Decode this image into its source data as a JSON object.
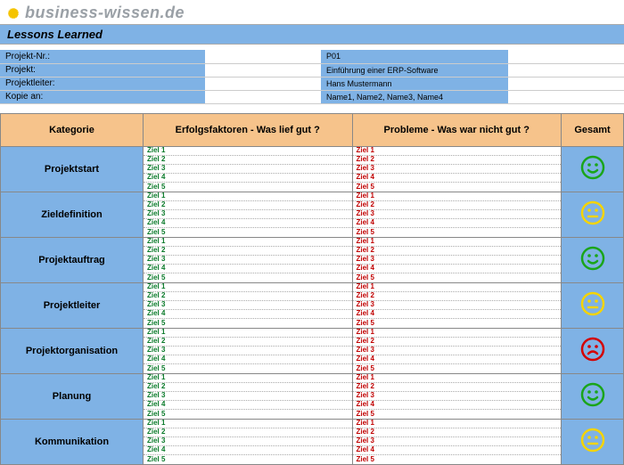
{
  "brand": "business-wissen.de",
  "title": "Lessons Learned",
  "meta": [
    {
      "label": "Projekt-Nr.:",
      "value": "P01"
    },
    {
      "label": "Projekt:",
      "value": "Einführung einer ERP-Software"
    },
    {
      "label": "Projektleiter:",
      "value": "Hans Mustermann"
    },
    {
      "label": "Kopie an:",
      "value": "Name1, Name2, Name3, Name4"
    }
  ],
  "columns": {
    "category": "Kategorie",
    "success": "Erfolgsfaktoren - Was lief gut ?",
    "problems": "Probleme - Was war nicht gut ?",
    "total": "Gesamt"
  },
  "ziel_labels": [
    "Ziel 1",
    "Ziel 2",
    "Ziel 3",
    "Ziel 4",
    "Ziel 5"
  ],
  "rows": [
    {
      "category": "Projektstart",
      "rating": "green"
    },
    {
      "category": "Zieldefinition",
      "rating": "yellow"
    },
    {
      "category": "Projektauftrag",
      "rating": "green"
    },
    {
      "category": "Projektleiter",
      "rating": "yellow"
    },
    {
      "category": "Projektorganisation",
      "rating": "red"
    },
    {
      "category": "Planung",
      "rating": "green"
    },
    {
      "category": "Kommunikation",
      "rating": "yellow"
    }
  ],
  "colors": {
    "green": "#1aa51a",
    "yellow": "#f5d400",
    "red": "#d40000"
  }
}
